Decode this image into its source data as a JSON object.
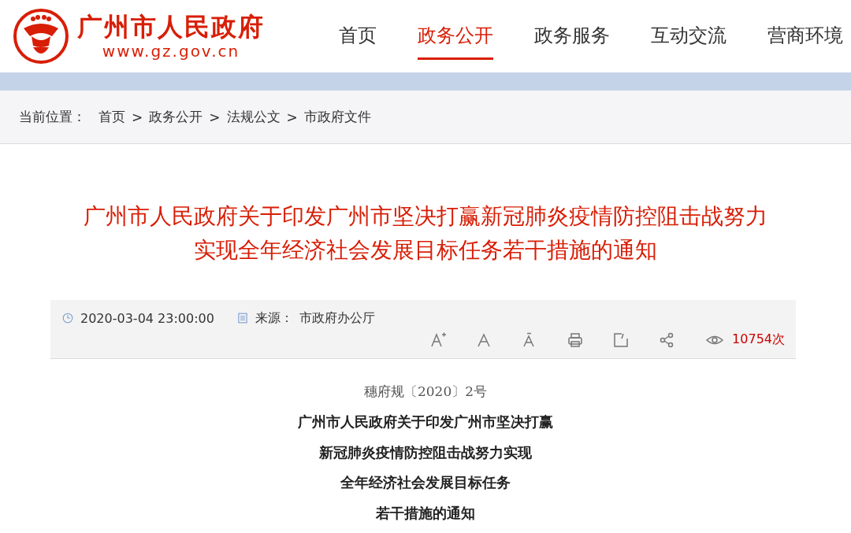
{
  "header": {
    "logo_title": "广州市人民政府",
    "logo_url": "www.gz.gov.cn",
    "nav": [
      {
        "label": "首页",
        "selected": false
      },
      {
        "label": "政务公开",
        "selected": true
      },
      {
        "label": "政务服务",
        "selected": false
      },
      {
        "label": "互动交流",
        "selected": false
      },
      {
        "label": "营商环境",
        "selected": false
      }
    ]
  },
  "breadcrumb": {
    "label": "当前位置：",
    "items": [
      "首页",
      "政务公开",
      "法规公文",
      "市政府文件"
    ],
    "separator": ">"
  },
  "article": {
    "title_lines": [
      "广州市人民政府关于印发广州市坚决打赢新冠肺炎疫情防控阻击战努力",
      "实现全年经济社会发展目标任务若干措施的通知"
    ],
    "date": "2020-03-04 23:00:00",
    "source_label": "来源：",
    "source": "市政府办公厅",
    "views": "10754次",
    "doc_number": "穗府规〔2020〕2号",
    "doc_title_lines": [
      "广州市人民政府关于印发广州市坚决打赢",
      "新冠肺炎疫情防控阻击战努力实现",
      "全年经济社会发展目标任务",
      "若干措施的通知"
    ]
  }
}
